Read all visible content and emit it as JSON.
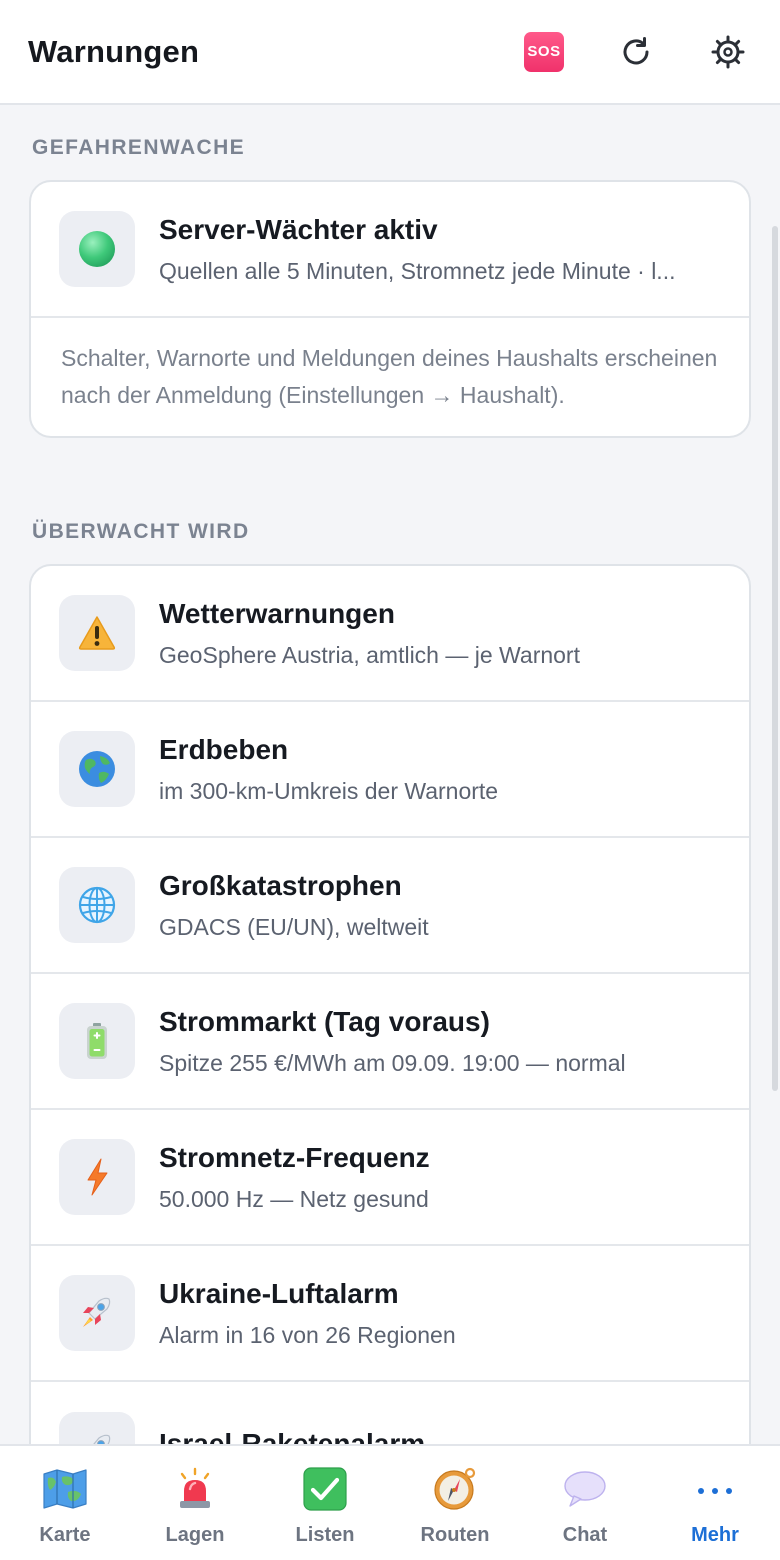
{
  "header": {
    "title": "Warnungen",
    "sos_label": "SOS"
  },
  "sections": [
    {
      "title": "GEFAHRENWACHE"
    },
    {
      "title": "ÜBERWACHT WIRD"
    }
  ],
  "watcher": {
    "title": "Server-Wächter aktiv",
    "subtitle": "Quellen alle 5 Minuten, Stromnetz jede Minute · l...",
    "note": "Schalter, Warnorte und Meldungen deines Haushalts erscheinen nach der Anmeldung (Einstellungen → Haushalt).",
    "status_color": "#3fc97a"
  },
  "monitored": [
    {
      "icon": "warning-icon",
      "title": "Wetterwarnungen",
      "subtitle": "GeoSphere Austria, amtlich — je Warnort"
    },
    {
      "icon": "earth-globe-icon",
      "title": "Erdbeben",
      "subtitle": "im 300-km-Umkreis der Warnorte"
    },
    {
      "icon": "globe-meridians-icon",
      "title": "Großkatastrophen",
      "subtitle": "GDACS (EU/UN), weltweit"
    },
    {
      "icon": "battery-icon",
      "title": "Strommarkt (Tag voraus)",
      "subtitle": "Spitze 255 €/MWh am 09.09. 19:00 — normal"
    },
    {
      "icon": "lightning-icon",
      "title": "Stromnetz-Frequenz",
      "subtitle": "50.000 Hz — Netz gesund"
    },
    {
      "icon": "rocket-icon",
      "title": "Ukraine-Luftalarm",
      "subtitle": "Alarm in 16 von 26 Regionen"
    },
    {
      "icon": "rocket-icon",
      "title": "Israel-Raketenalarm",
      "subtitle": ""
    }
  ],
  "tabs": [
    {
      "label": "Karte",
      "icon": "map-icon",
      "active": false
    },
    {
      "label": "Lagen",
      "icon": "siren-icon",
      "active": false
    },
    {
      "label": "Listen",
      "icon": "checkbox-icon",
      "active": false
    },
    {
      "label": "Routen",
      "icon": "compass-icon",
      "active": false
    },
    {
      "label": "Chat",
      "icon": "speech-bubble-icon",
      "active": false
    },
    {
      "label": "Mehr",
      "icon": "more-dots-icon",
      "active": true
    }
  ],
  "colors": {
    "accent": "#1d6fd6",
    "sos": "#f0326b"
  }
}
